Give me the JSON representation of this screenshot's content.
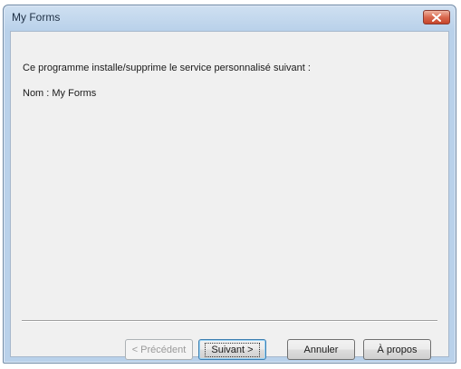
{
  "window": {
    "title": "My Forms"
  },
  "content": {
    "description": "Ce programme installe/supprime le service personnalisé suivant :",
    "name_line": "Nom : My Forms"
  },
  "buttons": {
    "previous": "< Précédent",
    "next": "Suivant >",
    "cancel": "Annuler",
    "about": "À propos"
  },
  "icons": {
    "close": "close-icon"
  },
  "colors": {
    "titlebar": "#b9d1ea",
    "close_button": "#c6452b",
    "client_background": "#f0f0f0"
  }
}
